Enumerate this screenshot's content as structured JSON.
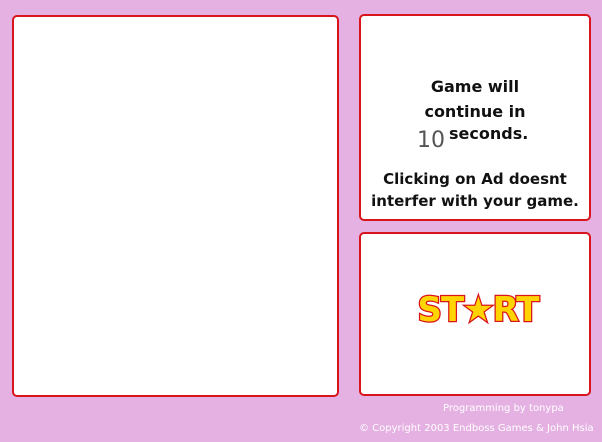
{
  "ad_panel": {
    "empty": true
  },
  "info": {
    "line1": "Game will",
    "line2": "continue in",
    "countdown": "10",
    "seconds_label": "seconds.",
    "note_line1": "Clicking on Ad doesnt",
    "note_line2": "interfer with your game."
  },
  "start_button": {
    "label": "ST★RT"
  },
  "footer": {
    "programming": "Programming by tonypa",
    "copyright": "© Copyright 2003 Endboss Games & John Hsia"
  },
  "colors": {
    "background": "#e5b1e3",
    "panel_border": "#d8141c",
    "start_fill": "#ffd400",
    "start_outline": "#d8141c"
  }
}
